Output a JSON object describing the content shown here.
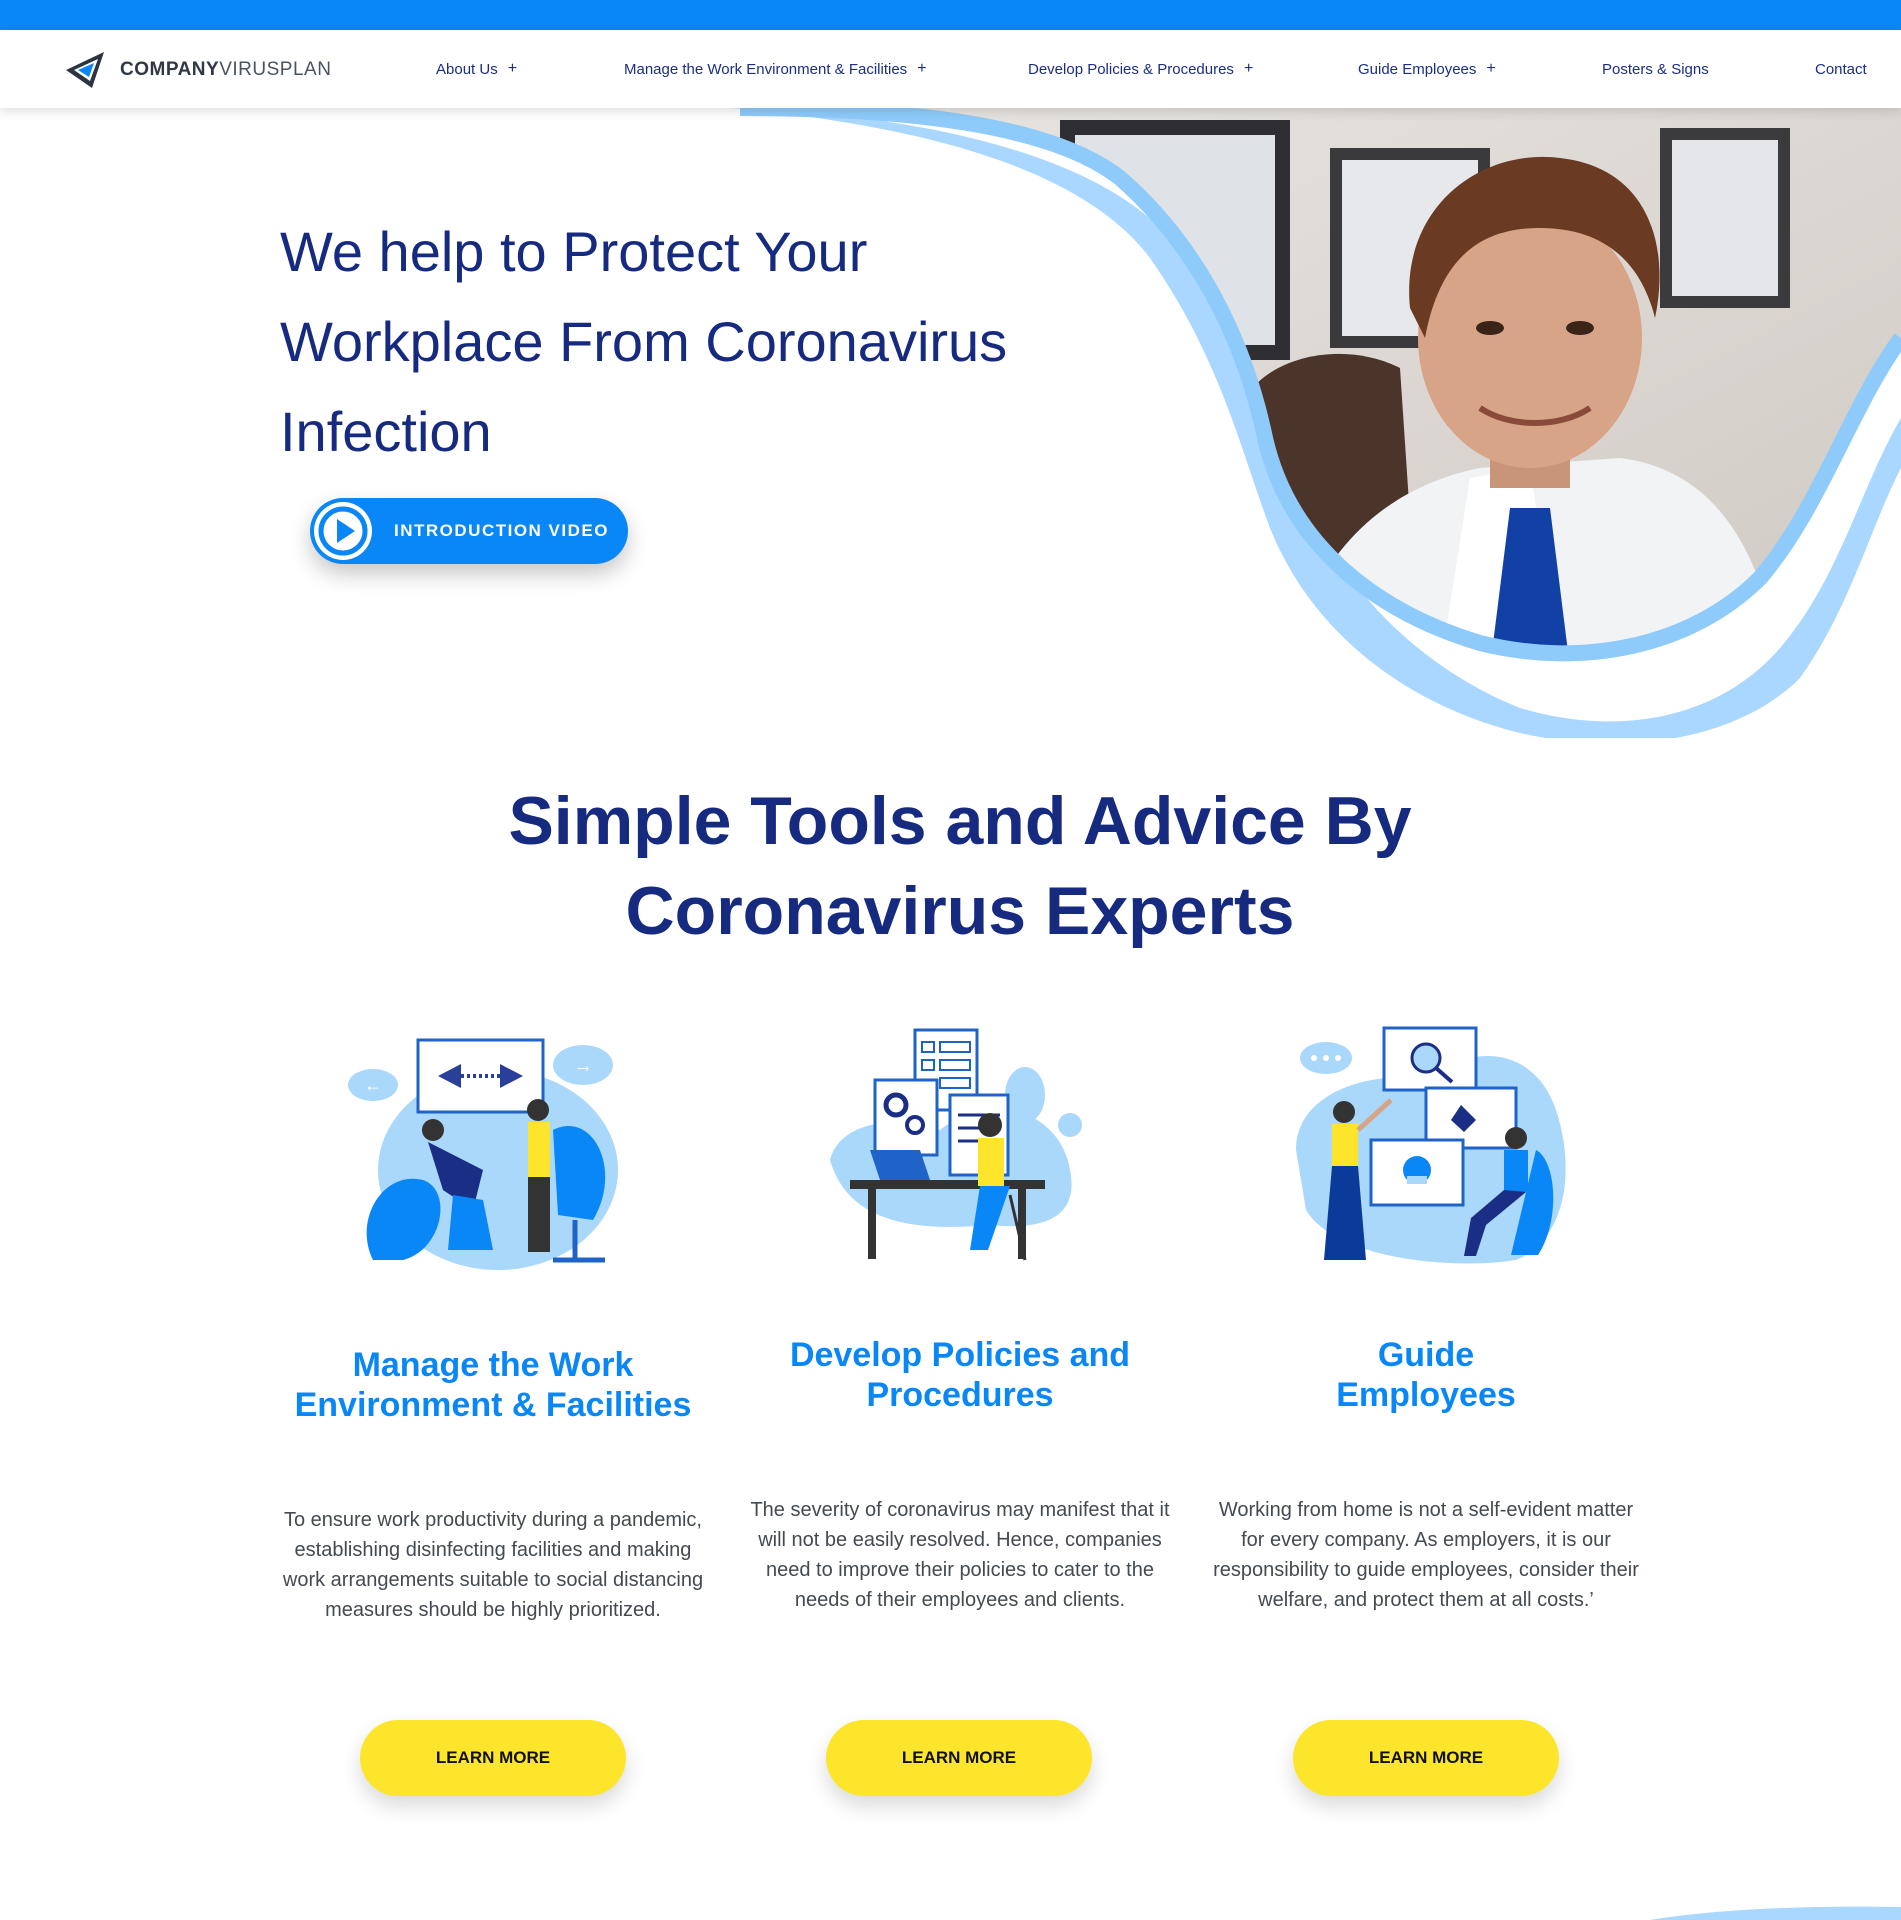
{
  "brand": {
    "name_bold": "COMPANY",
    "name_light": "VIRUSPLAN",
    "accent": "#0a87f7",
    "navy": "#162a80",
    "yellow": "#fde52c"
  },
  "nav": {
    "items": [
      {
        "label": "About Us",
        "has_submenu": true
      },
      {
        "label": "Manage the Work Environment & Facilities",
        "has_submenu": true
      },
      {
        "label": "Develop Policies & Procedures",
        "has_submenu": true
      },
      {
        "label": "Guide Employees",
        "has_submenu": true
      },
      {
        "label": "Posters & Signs",
        "has_submenu": false
      },
      {
        "label": "Contact",
        "has_submenu": false
      }
    ],
    "plus": "+"
  },
  "hero": {
    "title_line1": "We help to Protect Your",
    "title_line2": "Workplace From Coronavirus",
    "title_line3": "Infection",
    "video_button": "INTRODUCTION VIDEO"
  },
  "section": {
    "title_line1": "Simple Tools and Advice By",
    "title_line2": "Coronavirus Experts"
  },
  "cards": [
    {
      "title_line1": "Manage the Work",
      "title_line2": "Environment & Facilities",
      "text": "To ensure work productivity during a pandemic, establishing disinfecting facilities and making work arrangements suitable to social distancing measures should be highly prioritized.",
      "button": "LEARN MORE"
    },
    {
      "title_line1": "Develop Policies and",
      "title_line2": "Procedures",
      "text": "The severity of coronavirus may manifest that it will not be easily resolved. Hence, companies need to improve their policies to cater to the needs of their employees and clients.",
      "button": "LEARN MORE"
    },
    {
      "title_line1": "Guide",
      "title_line2": "Employees",
      "text": "Working from home is not a self-evident matter for every company. As employers, it is our responsibility to guide employees, consider their welfare, and protect them at all costs.’",
      "button": "LEARN MORE"
    }
  ]
}
